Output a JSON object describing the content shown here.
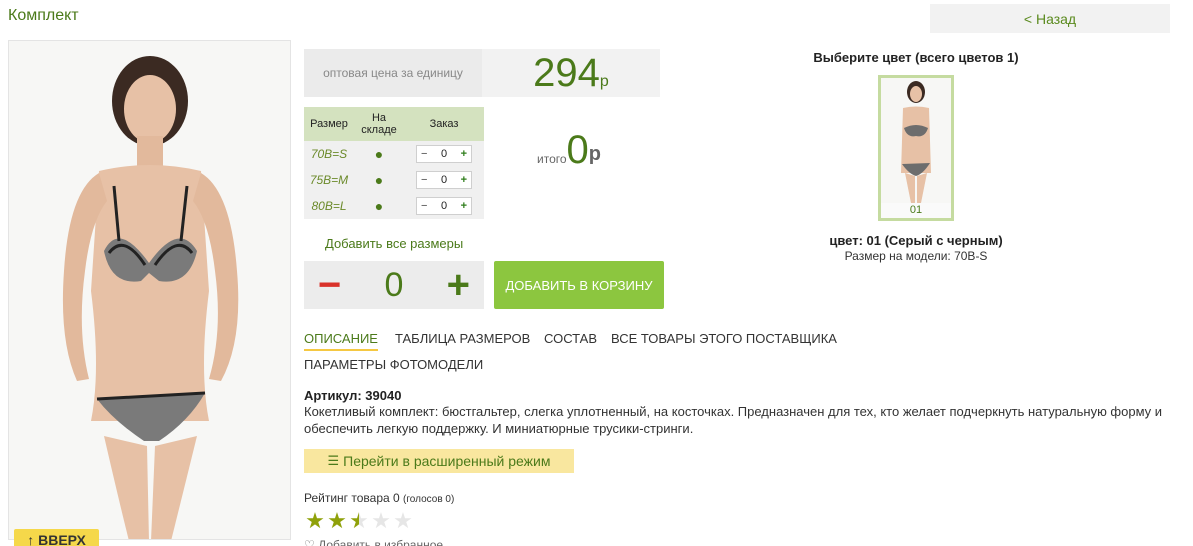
{
  "page": {
    "title": "Комплект",
    "back_label": "< Назад"
  },
  "photo": {
    "up_label": "↑ ВВЕРХ"
  },
  "price": {
    "label": "оптовая цена за единицу",
    "value": "294",
    "currency": "р"
  },
  "sizes": {
    "headers": [
      "Размер",
      "На складе",
      "Заказ"
    ],
    "rows": [
      {
        "size": "70B=S",
        "stock": "●",
        "qty": "0"
      },
      {
        "size": "75B=M",
        "stock": "●",
        "qty": "0"
      },
      {
        "size": "80B=L",
        "stock": "●",
        "qty": "0"
      }
    ],
    "minus": "−",
    "plus": "+"
  },
  "total": {
    "label": "итого",
    "value": "0",
    "currency": "р"
  },
  "add_all_label": "Добавить все размеры",
  "order": {
    "minus": "−",
    "value": "0",
    "plus": "+",
    "cart_label": "ДОБАВИТЬ В КОРЗИНУ"
  },
  "tabs": [
    "ОПИСАНИЕ",
    "ТАБЛИЦА РАЗМЕРОВ",
    "СОСТАВ",
    "ВСЕ ТОВАРЫ ЭТОГО ПОСТАВЩИКА",
    "ПАРАМЕТРЫ ФОТОМОДЕЛИ"
  ],
  "article": "Артикул: 39040",
  "description": "Кокетливый комплект: бюстгальтер, слегка уплотненный, на косточках. Предназначен для тех, кто желает подчеркнуть натуральную форму и обеспечить легкую поддержку. И миниатюрные трусики-стринги.",
  "advanced_label": "Перейти в расширенный режим",
  "rating": {
    "label": "Рейтинг товара 0",
    "votes": "(голосов 0)",
    "stars_value": 2.5,
    "stars_max": 5
  },
  "favorite_label": "Добавить в избранное",
  "colors": {
    "title": "Выберите цвет (всего цветов 1)",
    "thumb_number": "01",
    "selected": "цвет: 01 (Серый с черным)",
    "model_size": "Размер на модели: 70B-S"
  },
  "accent": "#4b7a1a",
  "cart_color": "#8cc63f"
}
